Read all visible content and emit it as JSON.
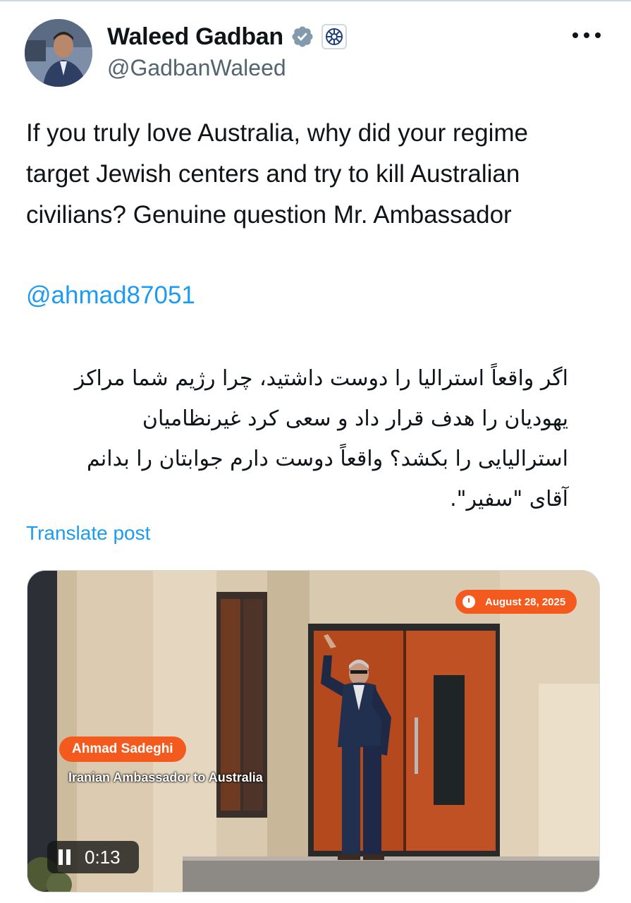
{
  "author": {
    "name": "Waleed Gadban",
    "handle": "@GadbanWaleed",
    "verified_icon": "verified-badge-icon",
    "affiliation_icon": "affiliate-org-icon"
  },
  "tweet": {
    "text": "If you truly love Australia, why did your regime target Jewish centers and try to kill Australian civilians? Genuine question Mr. Ambassador",
    "mention": "@ahmad87051",
    "persian_lines": [
      "اگر واقعاً استرالیا را دوست داشتید، چرا رژیم شما مراکز",
      "یهودیان را هدف قرار داد و سعی کرد غیرنظامیان",
      "استرالیایی را بکشد؟ واقعاً دوست دارم جوابتان را بدانم",
      "آقای \"سفیر\"."
    ],
    "translate_label": "Translate post"
  },
  "media": {
    "date": "August 28, 2025",
    "person_name": "Ahmad Sadeghi",
    "person_role": "Iranian Ambassador to Australia",
    "player_time": "0:13"
  },
  "colors": {
    "link": "#1d9bf0",
    "accent_orange": "#f45a1e",
    "text": "#0f1419",
    "secondary": "#536471"
  }
}
